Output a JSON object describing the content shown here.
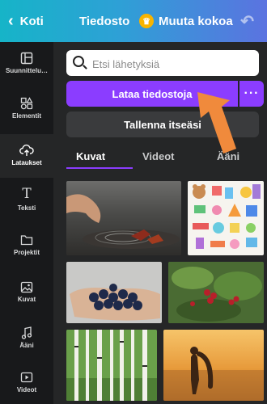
{
  "topbar": {
    "back_label": "Koti",
    "file_label": "Tiedosto",
    "resize_label": "Muuta kokoa"
  },
  "sidebar": {
    "items": [
      {
        "label": "Suunnittelu…",
        "icon": "layout-icon"
      },
      {
        "label": "Elementit",
        "icon": "elements-icon"
      },
      {
        "label": "Lataukset",
        "icon": "cloud-upload-icon"
      },
      {
        "label": "Teksti",
        "icon": "text-icon"
      },
      {
        "label": "Projektit",
        "icon": "folder-icon"
      },
      {
        "label": "Kuvat",
        "icon": "image-icon"
      },
      {
        "label": "Ääni",
        "icon": "music-icon"
      },
      {
        "label": "Videot",
        "icon": "video-icon"
      }
    ]
  },
  "search": {
    "placeholder": "Etsi lähetyksiä"
  },
  "upload": {
    "label": "Lataa tiedostoja",
    "more": "···"
  },
  "record": {
    "label": "Tallenna itseäsi"
  },
  "tabs": [
    {
      "label": "Kuvat"
    },
    {
      "label": "Videot"
    },
    {
      "label": "Ääni"
    }
  ],
  "colors": {
    "accent": "#8b3dff",
    "annotation_arrow": "#f08a3c"
  }
}
